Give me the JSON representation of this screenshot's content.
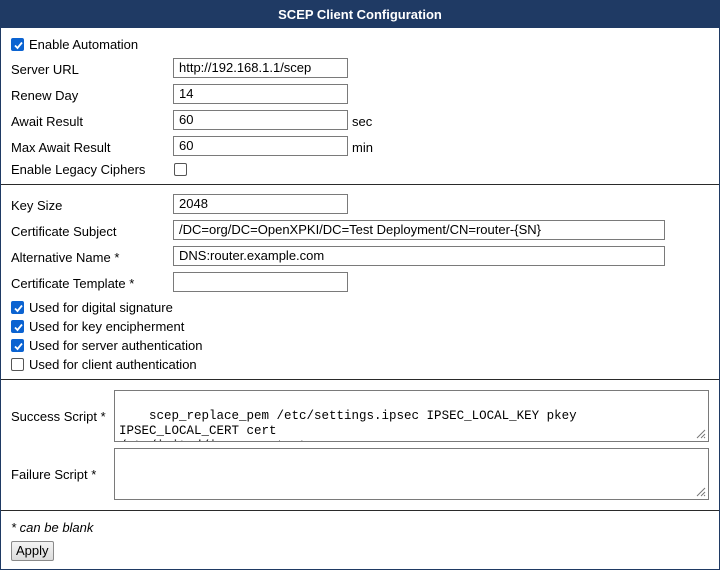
{
  "title": "SCEP Client Configuration",
  "general": {
    "enable_automation": {
      "label": "Enable Automation",
      "checked": true
    },
    "server_url": {
      "label": "Server URL",
      "value": "http://192.168.1.1/scep"
    },
    "renew_day": {
      "label": "Renew Day",
      "value": "14"
    },
    "await_result": {
      "label": "Await Result",
      "value": "60",
      "unit": "sec"
    },
    "max_await_result": {
      "label": "Max Await Result",
      "value": "60",
      "unit": "min"
    },
    "enable_legacy_ciphers": {
      "label": "Enable Legacy Ciphers",
      "checked": false
    }
  },
  "certificate": {
    "key_size": {
      "label": "Key Size",
      "value": "2048"
    },
    "certificate_subject": {
      "label": "Certificate Subject",
      "value": "/DC=org/DC=OpenXPKI/DC=Test Deployment/CN=router-{SN}"
    },
    "alternative_name": {
      "label": "Alternative Name *",
      "value": "DNS:router.example.com"
    },
    "certificate_template": {
      "label": "Certificate Template *",
      "value": ""
    },
    "usages": [
      {
        "label": "Used for digital signature",
        "checked": true
      },
      {
        "label": "Used for key encipherment",
        "checked": true
      },
      {
        "label": "Used for server authentication",
        "checked": true
      },
      {
        "label": "Used for client authentication",
        "checked": false
      }
    ]
  },
  "scripts": {
    "success_script": {
      "label": "Success Script *",
      "value": "scep_replace_pem /etc/settings.ipsec IPSEC_LOCAL_KEY pkey IPSEC_LOCAL_CERT cert\n/etc/init.d/ipsec restart"
    },
    "failure_script": {
      "label": "Failure Script *",
      "value": ""
    }
  },
  "footer": {
    "note": "* can be blank",
    "apply_label": "Apply"
  }
}
